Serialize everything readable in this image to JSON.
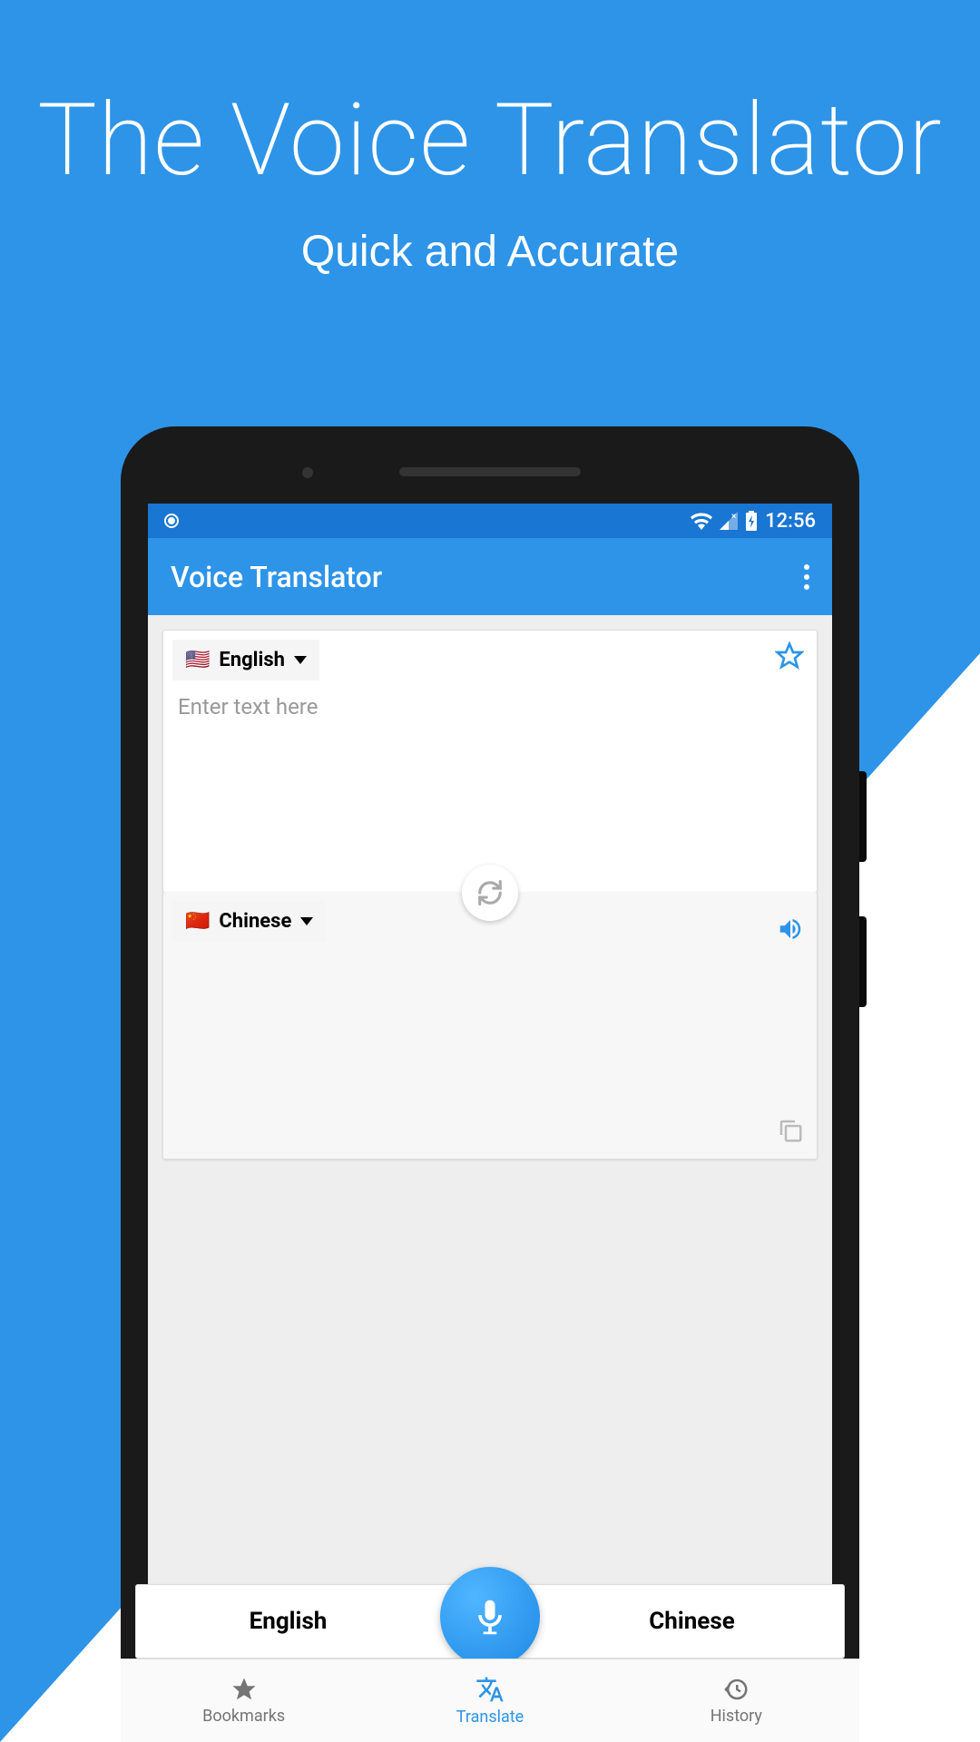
{
  "hero": {
    "title": "The Voice Translator",
    "subtitle": "Quick and Accurate"
  },
  "status": {
    "time": "12:56"
  },
  "appbar": {
    "title": "Voice Translator"
  },
  "input": {
    "language": "English",
    "flag": "🇺🇸",
    "placeholder": "Enter text here"
  },
  "output": {
    "language": "Chinese",
    "flag": "🇨🇳"
  },
  "voice": {
    "left_language": "English",
    "right_language": "Chinese"
  },
  "nav": {
    "bookmarks": "Bookmarks",
    "translate": "Translate",
    "history": "History"
  },
  "colors": {
    "primary": "#2d94e8",
    "accent": "#1e88e5"
  }
}
